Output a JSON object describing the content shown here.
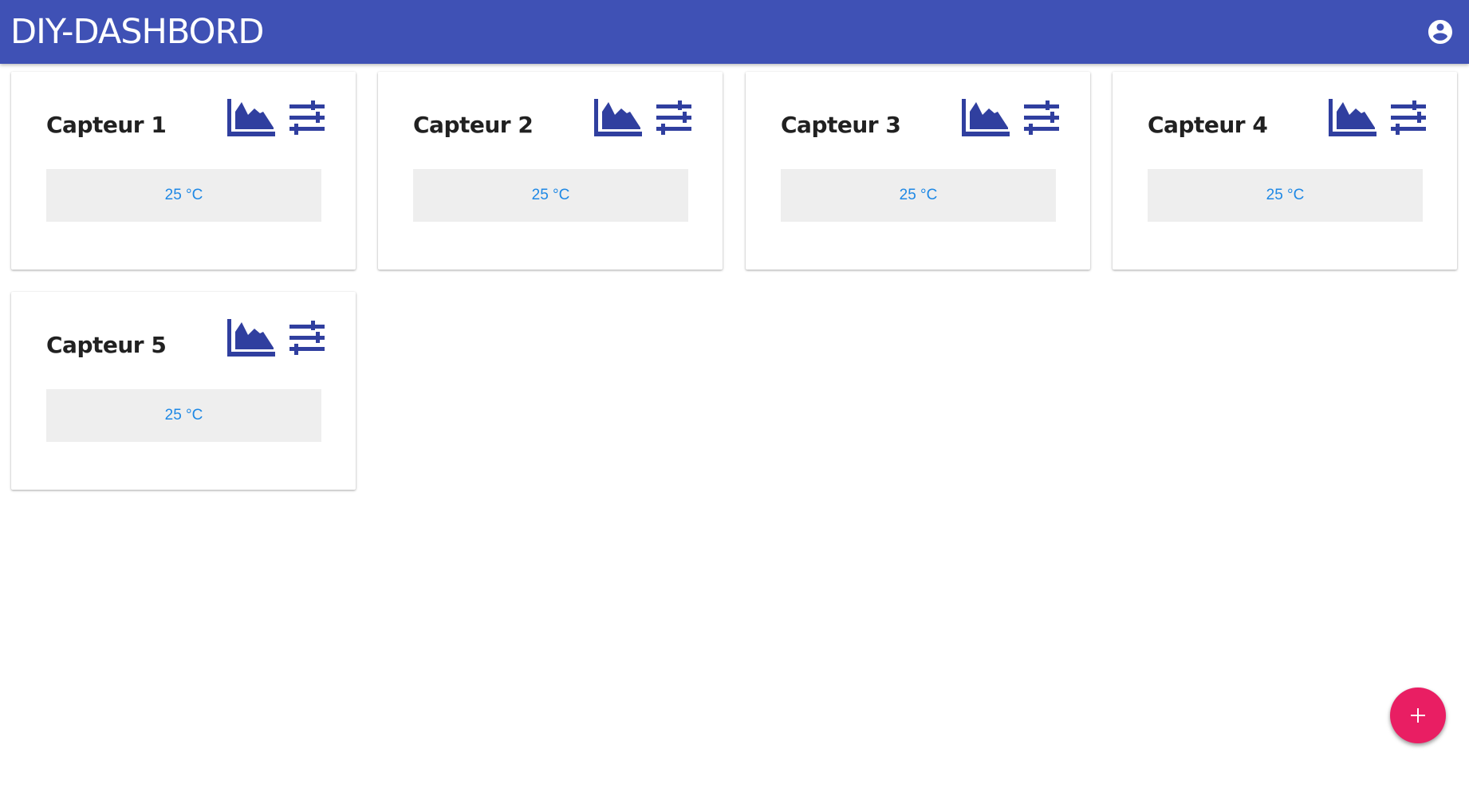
{
  "app": {
    "title": "DIY-DASHBORD",
    "account_icon": "account-circle-icon"
  },
  "colors": {
    "app_bar": "#3f51b5",
    "icon": "#303f9f",
    "value_text": "#1e88e5",
    "value_bg": "#eeeeee",
    "fab": "#e91e63"
  },
  "sensors": [
    {
      "name": "Capteur 1",
      "value": "25 °C",
      "chart_icon": "area-chart-icon",
      "settings_icon": "tune-sliders-icon"
    },
    {
      "name": "Capteur 2",
      "value": "25 °C",
      "chart_icon": "area-chart-icon",
      "settings_icon": "tune-sliders-icon"
    },
    {
      "name": "Capteur 3",
      "value": "25 °C",
      "chart_icon": "area-chart-icon",
      "settings_icon": "tune-sliders-icon"
    },
    {
      "name": "Capteur 4",
      "value": "25 °C",
      "chart_icon": "area-chart-icon",
      "settings_icon": "tune-sliders-icon"
    },
    {
      "name": "Capteur 5",
      "value": "25 °C",
      "chart_icon": "area-chart-icon",
      "settings_icon": "tune-sliders-icon"
    }
  ],
  "fab": {
    "icon": "add-icon"
  }
}
